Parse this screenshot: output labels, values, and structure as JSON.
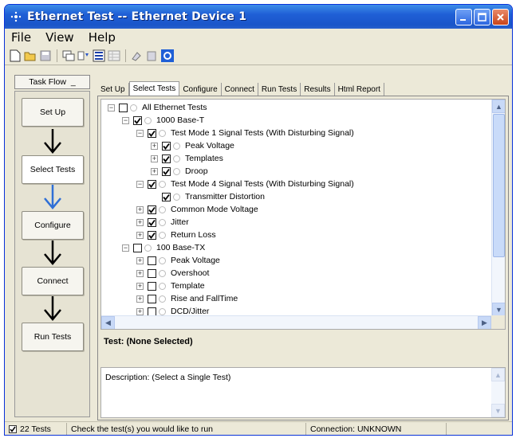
{
  "window": {
    "title": "Ethernet Test -- Ethernet Device 1"
  },
  "menu": [
    "File",
    "View",
    "Help"
  ],
  "toolbar_icons": [
    "new-icon",
    "open-icon",
    "save-icon",
    "properties-icon",
    "filter-icon",
    "run-icon",
    "grid-icon",
    "copy-icon",
    "paste-icon",
    "info-icon"
  ],
  "taskflow": {
    "header": "Task Flow",
    "steps": [
      "Set Up",
      "Select Tests",
      "Configure",
      "Connect",
      "Run Tests"
    ],
    "active": "Select Tests"
  },
  "tabs": [
    "Set Up",
    "Select Tests",
    "Configure",
    "Connect",
    "Run Tests",
    "Results",
    "Html Report"
  ],
  "active_tab": "Select Tests",
  "tree": [
    {
      "label": "All Ethernet Tests",
      "level": 0,
      "expander": "-",
      "checked": false
    },
    {
      "label": "1000 Base-T",
      "level": 1,
      "expander": "-",
      "checked": true
    },
    {
      "label": "Test Mode 1 Signal Tests (With Disturbing Signal)",
      "level": 2,
      "expander": "-",
      "checked": true
    },
    {
      "label": "Peak Voltage",
      "level": 3,
      "expander": "+",
      "checked": true
    },
    {
      "label": "Templates",
      "level": 3,
      "expander": "+",
      "checked": true
    },
    {
      "label": "Droop",
      "level": 3,
      "expander": "+",
      "checked": true
    },
    {
      "label": "Test Mode 4 Signal Tests (With Disturbing Signal)",
      "level": 2,
      "expander": "-",
      "checked": true
    },
    {
      "label": "Transmitter Distortion",
      "level": 3,
      "expander": "",
      "checked": true
    },
    {
      "label": "Common Mode Voltage",
      "level": 2,
      "expander": "+",
      "checked": true
    },
    {
      "label": "Jitter",
      "level": 2,
      "expander": "+",
      "checked": true
    },
    {
      "label": "Return Loss",
      "level": 2,
      "expander": "+",
      "checked": true
    },
    {
      "label": "100 Base-TX",
      "level": 1,
      "expander": "-",
      "checked": false
    },
    {
      "label": "Peak Voltage",
      "level": 2,
      "expander": "+",
      "checked": false
    },
    {
      "label": "Overshoot",
      "level": 2,
      "expander": "+",
      "checked": false
    },
    {
      "label": "Template",
      "level": 2,
      "expander": "+",
      "checked": false
    },
    {
      "label": "Rise and FallTime",
      "level": 2,
      "expander": "+",
      "checked": false
    },
    {
      "label": "DCD/Jitter",
      "level": 2,
      "expander": "+",
      "checked": false
    }
  ],
  "test_label": "Test: (None Selected)",
  "description": "Description: (Select a Single Test)",
  "status": {
    "count": "22 Tests",
    "message": "Check the test(s) you would like to run",
    "connection": "Connection: UNKNOWN"
  },
  "colors": {
    "titlebar": "#1f5fd6",
    "window_bg": "#ece9d8",
    "arrow_active": "#2f6fd6"
  }
}
